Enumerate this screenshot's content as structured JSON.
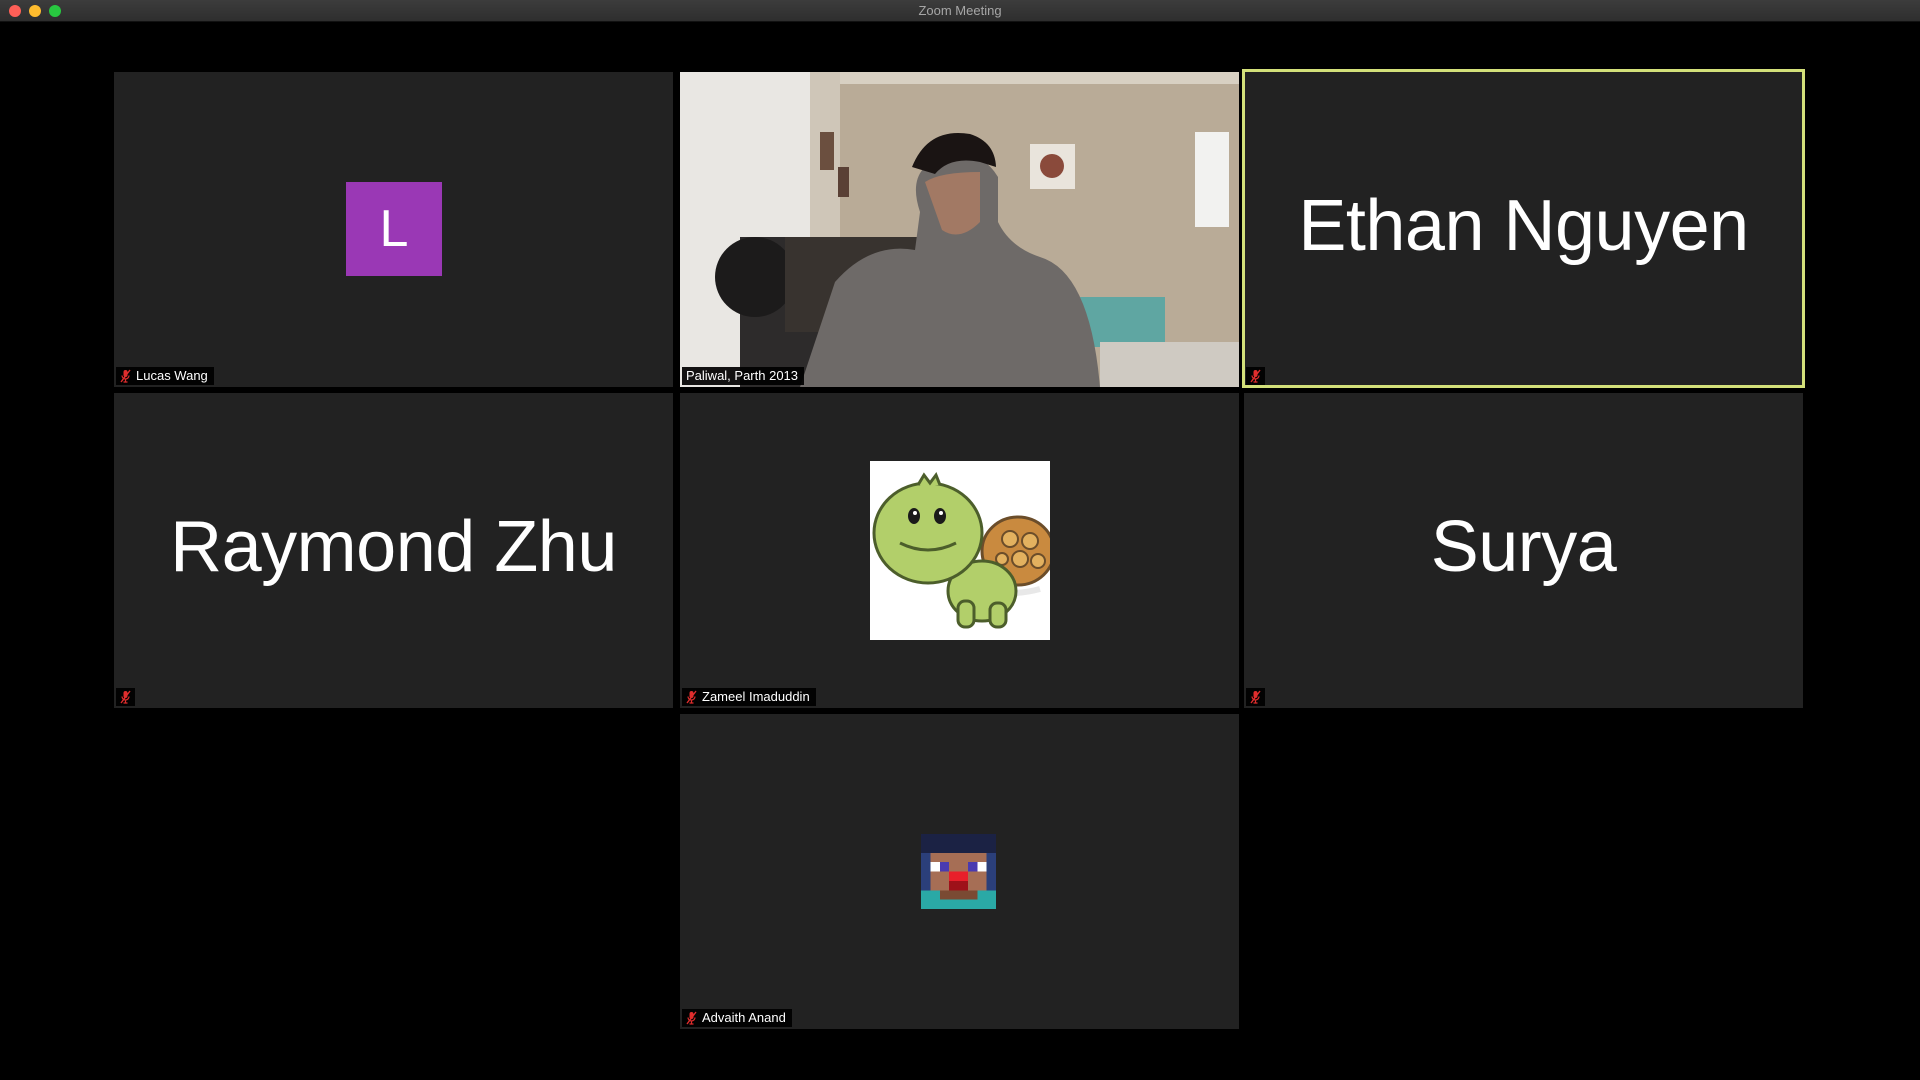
{
  "window": {
    "title": "Zoom Meeting"
  },
  "participants": [
    {
      "name": "Lucas Wang",
      "avatar_letter": "L",
      "avatar_color": "#9a38b5",
      "muted": true
    },
    {
      "name": "Paliwal, Parth 2013",
      "video_on": true,
      "muted": false
    },
    {
      "display_name": "Ethan Nguyen",
      "muted": true,
      "active_speaker": true
    },
    {
      "display_name": "Raymond Zhu",
      "muted": true
    },
    {
      "name": "Zameel Imaduddin",
      "profile_picture": "turtle-icon",
      "muted": true
    },
    {
      "display_name": "Surya",
      "muted": true
    },
    {
      "name": "Advaith Anand",
      "profile_picture": "minecraft-head-icon",
      "muted": true
    }
  ],
  "colors": {
    "active_speaker_border": "#d3e07a",
    "mute_icon": "#e02d2d",
    "tile_bg": "#222222"
  }
}
